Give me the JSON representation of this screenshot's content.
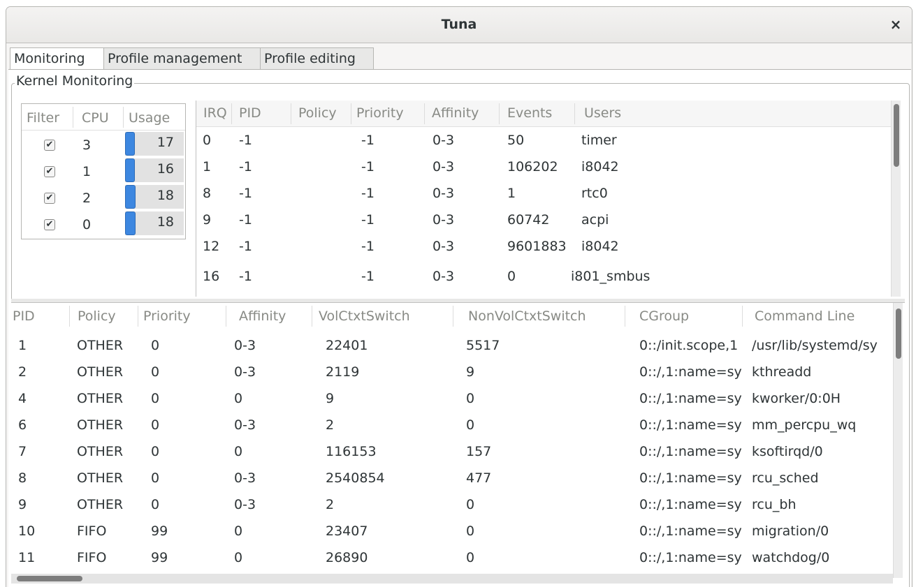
{
  "window": {
    "title": "Tuna",
    "close_glyph": "×"
  },
  "tabs": [
    {
      "label": "Monitoring",
      "active": true
    },
    {
      "label": "Profile management",
      "active": false
    },
    {
      "label": "Profile editing",
      "active": false
    }
  ],
  "frame": {
    "label": "Kernel Monitoring"
  },
  "cpu_list": {
    "headers": [
      "Filter",
      "CPU",
      "Usage"
    ],
    "rows": [
      {
        "checked": true,
        "cpu": "3",
        "usage": "17"
      },
      {
        "checked": true,
        "cpu": "1",
        "usage": "16"
      },
      {
        "checked": true,
        "cpu": "2",
        "usage": "18"
      },
      {
        "checked": true,
        "cpu": "0",
        "usage": "18"
      }
    ]
  },
  "irq_list": {
    "headers": [
      "IRQ",
      "PID",
      "Policy",
      "Priority",
      "Affinity",
      "Events",
      "Users"
    ],
    "rows": [
      [
        "0",
        "-1",
        "",
        "-1",
        "0-3",
        "50",
        "timer"
      ],
      [
        "1",
        "-1",
        "",
        "-1",
        "0-3",
        "106202",
        "i8042"
      ],
      [
        "8",
        "-1",
        "",
        "-1",
        "0-3",
        "1",
        "rtc0"
      ],
      [
        "9",
        "-1",
        "",
        "-1",
        "0-3",
        "60742",
        "acpi"
      ],
      [
        "12",
        "-1",
        "",
        "-1",
        "0-3",
        "9601883",
        "i8042"
      ],
      [
        "16",
        "-1",
        "",
        "-1",
        "0-3",
        "0",
        "i801_smbus"
      ]
    ]
  },
  "process_list": {
    "headers": [
      "PID",
      "Policy",
      "Priority",
      "Affinity",
      "VolCtxtSwitch",
      "NonVolCtxtSwitch",
      "CGroup",
      "Command Line"
    ],
    "rows": [
      [
        "1",
        "OTHER",
        "0",
        "0-3",
        "22401",
        "5517",
        "0::/init.scope,1",
        "/usr/lib/systemd/sy"
      ],
      [
        "2",
        "OTHER",
        "0",
        "0-3",
        "2119",
        "9",
        "0::/,1:name=sy",
        "kthreadd"
      ],
      [
        "4",
        "OTHER",
        "0",
        "0",
        "9",
        "0",
        "0::/,1:name=sy",
        "kworker/0:0H"
      ],
      [
        "6",
        "OTHER",
        "0",
        "0-3",
        "2",
        "0",
        "0::/,1:name=sy",
        "mm_percpu_wq"
      ],
      [
        "7",
        "OTHER",
        "0",
        "0",
        "116153",
        "157",
        "0::/,1:name=sy",
        "ksoftirqd/0"
      ],
      [
        "8",
        "OTHER",
        "0",
        "0-3",
        "2540854",
        "477",
        "0::/,1:name=sy",
        "rcu_sched"
      ],
      [
        "9",
        "OTHER",
        "0",
        "0-3",
        "2",
        "0",
        "0::/,1:name=sy",
        "rcu_bh"
      ],
      [
        "10",
        "FIFO",
        "99",
        "0",
        "23407",
        "0",
        "0::/,1:name=sy",
        "migration/0"
      ],
      [
        "11",
        "FIFO",
        "99",
        "0",
        "26890",
        "0",
        "0::/,1:name=sy",
        "watchdog/0"
      ]
    ]
  },
  "colors": {
    "accent": "#3d87e0",
    "header_text": "#888a85"
  }
}
